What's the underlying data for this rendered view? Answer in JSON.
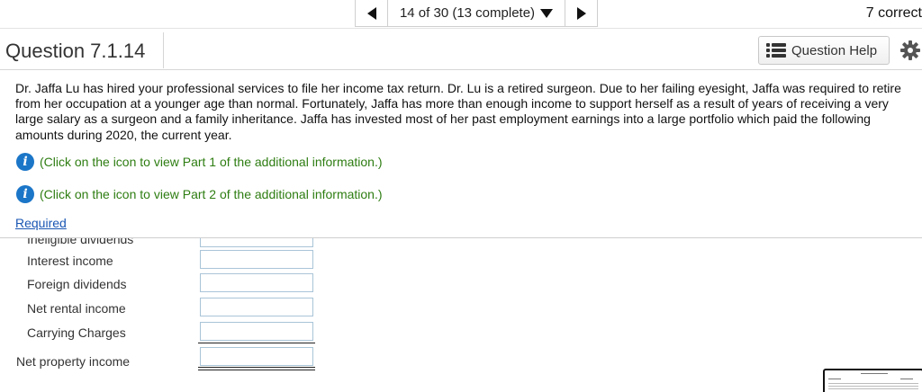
{
  "nav": {
    "position_text": "14 of 30 (13 complete)",
    "score_text": "7 correct"
  },
  "question": {
    "title": "Question 7.1.14",
    "help_label": "Question Help"
  },
  "body": {
    "text": "Dr. Jaffa Lu has hired your professional services to file her income tax return. Dr. Lu is a retired surgeon. Due to her failing eyesight, Jaffa was required to retire from her occupation at a younger age than normal. Fortunately, Jaffa has more than enough income to support herself as a result of years of receiving a very large salary as a surgeon and a family inheritance. Jaffa has invested most of her past employment earnings into a large portfolio which paid the following amounts during 2020, the current year.",
    "info_links": [
      "(Click on the icon to view Part 1 of the additional information.)",
      "(Click on the icon to view Part 2 of the additional information.)"
    ],
    "required_label": "Required"
  },
  "table": {
    "partial_row_label": "Ineligible dividends",
    "rows": [
      {
        "label": "Interest income",
        "value": ""
      },
      {
        "label": "Foreign dividends",
        "value": ""
      },
      {
        "label": "Net rental income",
        "value": ""
      },
      {
        "label": "Carrying Charges",
        "value": ""
      }
    ],
    "total_label": "Net property income",
    "total_value": ""
  },
  "icons": {
    "prev": "triangle-left-icon",
    "next": "triangle-right-icon",
    "dropdown": "chevron-down-icon",
    "help": "list-icon",
    "settings": "gear-icon",
    "info": "info-icon"
  },
  "colors": {
    "info_text": "#2e7d12",
    "info_icon": "#1b76c8",
    "link": "#1a56b3",
    "input_border": "#a9c4d8"
  }
}
